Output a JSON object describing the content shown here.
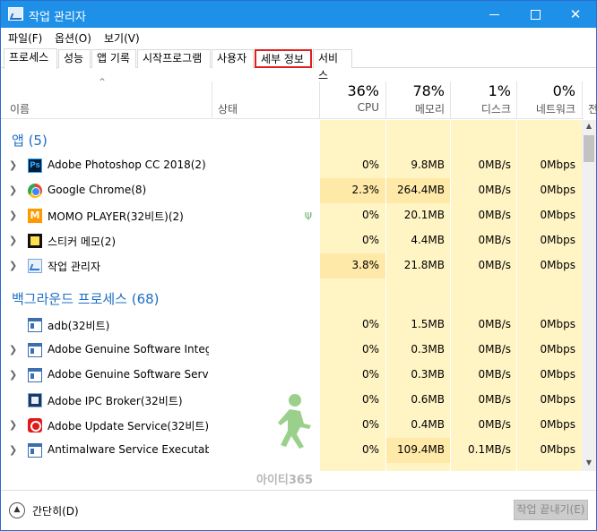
{
  "window": {
    "title": "작업 관리자"
  },
  "menu": [
    "파일(F)",
    "옵션(O)",
    "보기(V)"
  ],
  "tabs": [
    "프로세스",
    "성능",
    "앱 기록",
    "시작프로그램",
    "사용자",
    "세부 정보",
    "서비스"
  ],
  "columns": {
    "name": "이름",
    "status": "상태",
    "cpu": {
      "pct": "36%",
      "label": "CPU"
    },
    "memory": {
      "pct": "78%",
      "label": "메모리"
    },
    "disk": {
      "pct": "1%",
      "label": "디스크"
    },
    "network": {
      "pct": "0%",
      "label": "네트워크"
    },
    "power_cut": "전"
  },
  "groups": {
    "apps": {
      "title": "앱 (5)"
    },
    "background": {
      "title": "백그라운드 프로세스 (68)"
    }
  },
  "apps": [
    {
      "name": "Adobe Photoshop CC 2018(2)",
      "icon": "photoshop-icon",
      "cpu": "0%",
      "mem": "9.8MB",
      "disk": "0MB/s",
      "net": "0Mbps",
      "expandable": true
    },
    {
      "name": "Google Chrome(8)",
      "icon": "chrome-icon",
      "cpu": "2.3%",
      "mem": "264.4MB",
      "disk": "0MB/s",
      "net": "0Mbps",
      "expandable": true
    },
    {
      "name": "MOMO PLAYER(32비트)(2)",
      "icon": "momo-icon",
      "cpu": "0%",
      "mem": "20.1MB",
      "disk": "0MB/s",
      "net": "0Mbps",
      "expandable": true,
      "status_icon": "leaf-icon"
    },
    {
      "name": "스티커 메모(2)",
      "icon": "sticky-notes-icon",
      "cpu": "0%",
      "mem": "4.4MB",
      "disk": "0MB/s",
      "net": "0Mbps",
      "expandable": true
    },
    {
      "name": "작업 관리자",
      "icon": "task-manager-icon",
      "cpu": "3.8%",
      "mem": "21.8MB",
      "disk": "0MB/s",
      "net": "0Mbps",
      "expandable": true
    }
  ],
  "background": [
    {
      "name": "adb(32비트)",
      "icon": "window-icon",
      "cpu": "0%",
      "mem": "1.5MB",
      "disk": "0MB/s",
      "net": "0Mbps",
      "expandable": false
    },
    {
      "name": "Adobe Genuine Software Integr...",
      "icon": "window-icon",
      "cpu": "0%",
      "mem": "0.3MB",
      "disk": "0MB/s",
      "net": "0Mbps",
      "expandable": true
    },
    {
      "name": "Adobe Genuine Software Servi...",
      "icon": "window-icon",
      "cpu": "0%",
      "mem": "0.3MB",
      "disk": "0MB/s",
      "net": "0Mbps",
      "expandable": true
    },
    {
      "name": "Adobe IPC Broker(32비트)",
      "icon": "ipc-broker-icon",
      "cpu": "0%",
      "mem": "0.6MB",
      "disk": "0MB/s",
      "net": "0Mbps",
      "expandable": false
    },
    {
      "name": "Adobe Update Service(32비트)",
      "icon": "adobe-update-icon",
      "cpu": "0%",
      "mem": "0.4MB",
      "disk": "0MB/s",
      "net": "0Mbps",
      "expandable": true
    },
    {
      "name": "Antimalware Service Executable",
      "icon": "window-icon",
      "cpu": "0%",
      "mem": "109.4MB",
      "disk": "0.1MB/s",
      "net": "0Mbps",
      "expandable": true
    }
  ],
  "watermark": {
    "text": "아이티365"
  },
  "footer": {
    "collapse_label": "간단히(D)",
    "end_task": "작업 끝내기(E)"
  },
  "colors": {
    "titlebar": "#1e90e8",
    "heat_light": "#fff4c4",
    "heat_mid": "#ffe9a8",
    "group_title": "#1c6fc6",
    "tab_highlight": "#e02020"
  }
}
